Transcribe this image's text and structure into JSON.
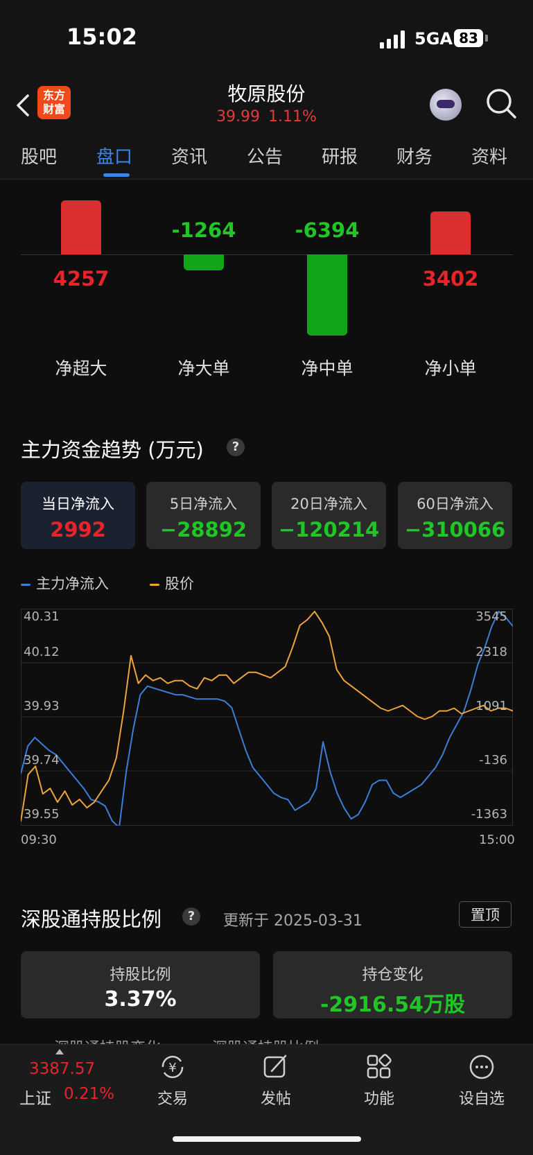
{
  "status_bar": {
    "time": "15:02",
    "network": "5GA",
    "battery": "83"
  },
  "header": {
    "logo_text": "东方\n财富",
    "stock_name": "牧原股份",
    "price": "39.99",
    "change_pct": "1.11%"
  },
  "tabs": [
    {
      "label": "股吧",
      "active": false
    },
    {
      "label": "盘口",
      "active": true
    },
    {
      "label": "资讯",
      "active": false
    },
    {
      "label": "公告",
      "active": false
    },
    {
      "label": "研报",
      "active": false
    },
    {
      "label": "财务",
      "active": false
    },
    {
      "label": "资料",
      "active": false
    }
  ],
  "flow_bars": [
    {
      "label": "净超大",
      "value": 4257,
      "text": "4257"
    },
    {
      "label": "净大单",
      "value": -1264,
      "text": "-1264"
    },
    {
      "label": "净中单",
      "value": -6394,
      "text": "-6394"
    },
    {
      "label": "净小单",
      "value": 3402,
      "text": "3402"
    }
  ],
  "trend": {
    "title": "主力资金趋势 (万元)",
    "help": "?",
    "cards": [
      {
        "label": "当日净流入",
        "value": "2992",
        "color": "red",
        "active": true
      },
      {
        "label": "5日净流入",
        "value": "−28892",
        "color": "green",
        "active": false
      },
      {
        "label": "20日净流入",
        "value": "−120214",
        "color": "green",
        "active": false
      },
      {
        "label": "60日净流入",
        "value": "−310066",
        "color": "green",
        "active": false
      }
    ],
    "legend": [
      {
        "name": "主力净流入",
        "color": "#3b7fd9"
      },
      {
        "name": "股价",
        "color": "#f0a43a"
      }
    ]
  },
  "chart_data": {
    "type": "line",
    "x_start": "09:30",
    "x_end": "15:00",
    "left_axis_ticks": [
      "40.31",
      "40.12",
      "39.93",
      "39.74",
      "39.55"
    ],
    "right_axis_ticks": [
      "3545",
      "2318",
      "1091",
      "-136",
      "-1363"
    ],
    "ylim_left": [
      39.55,
      40.31
    ],
    "ylim_right": [
      -1363,
      3545
    ],
    "series": [
      {
        "name": "主力净流入",
        "axis": "right",
        "color": "#3b7fd9",
        "values": [
          -250,
          400,
          600,
          450,
          300,
          200,
          0,
          -200,
          -400,
          -600,
          -850,
          -900,
          -1000,
          -1350,
          -1500,
          -200,
          800,
          1600,
          1800,
          1750,
          1700,
          1650,
          1600,
          1600,
          1550,
          1500,
          1500,
          1500,
          1500,
          1450,
          1300,
          800,
          300,
          -100,
          -300,
          -500,
          -700,
          -800,
          -850,
          -1100,
          -1000,
          -900,
          -600,
          500,
          -200,
          -700,
          -1050,
          -1300,
          -1200,
          -900,
          -500,
          -400,
          -400,
          -700,
          -800,
          -700,
          -600,
          -500,
          -300,
          -100,
          200,
          600,
          900,
          1200,
          1700,
          2300,
          2700,
          3200,
          3545,
          3400,
          3200
        ]
      },
      {
        "name": "股价",
        "axis": "left",
        "color": "#f0a43a",
        "values": [
          39.55,
          39.72,
          39.75,
          39.65,
          39.67,
          39.62,
          39.66,
          39.61,
          39.63,
          39.6,
          39.62,
          39.66,
          39.7,
          39.78,
          39.95,
          40.15,
          40.05,
          40.08,
          40.06,
          40.07,
          40.05,
          40.06,
          40.06,
          40.04,
          40.03,
          40.07,
          40.06,
          40.08,
          40.08,
          40.05,
          40.07,
          40.09,
          40.09,
          40.08,
          40.07,
          40.09,
          40.11,
          40.18,
          40.26,
          40.28,
          40.31,
          40.27,
          40.22,
          40.1,
          40.06,
          40.04,
          40.02,
          40.0,
          39.98,
          39.96,
          39.95,
          39.96,
          39.97,
          39.95,
          39.93,
          39.92,
          39.93,
          39.95,
          39.95,
          39.96,
          39.94,
          39.95,
          39.96,
          39.97,
          39.95,
          39.96,
          39.96,
          39.95
        ]
      }
    ]
  },
  "szconnect": {
    "title": "深股通持股比例",
    "help": "?",
    "updated": "更新于 2025-03-31",
    "pin_label": "置顶",
    "holding_label": "持股比例",
    "holding_value": "3.37%",
    "change_label": "持仓变化",
    "change_value": "-2916.54万股",
    "peek_left": "深股通持股变化",
    "peek_right": "深股通持股比例"
  },
  "bottom_bar": {
    "index_value": "3387.57",
    "index_name": "上证",
    "index_pct": "0.21%",
    "items": [
      {
        "label": "交易",
        "icon": "trade-yuan-icon"
      },
      {
        "label": "发帖",
        "icon": "compose-icon"
      },
      {
        "label": "功能",
        "icon": "grid-icon"
      },
      {
        "label": "设自选",
        "icon": "more-icon"
      }
    ]
  }
}
